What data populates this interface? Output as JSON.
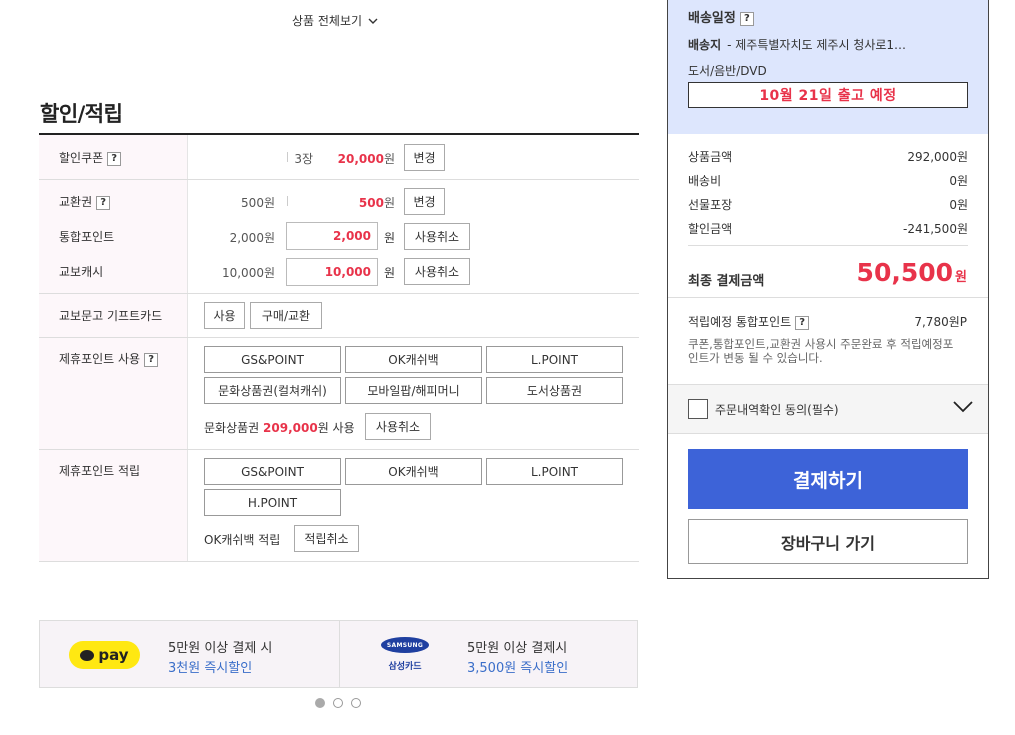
{
  "view_all": "상품 전체보기",
  "section_title": "할인/적립",
  "rows": {
    "coupon": {
      "label": "할인쿠폰",
      "count": "3장",
      "amount": "20,000",
      "won": "원",
      "btn": "변경"
    },
    "voucher": {
      "label": "교환권",
      "base": "500원",
      "amount": "500",
      "won": "원",
      "btn": "변경"
    },
    "point": {
      "label": "통합포인트",
      "base": "2,000원",
      "input": "2,000",
      "won": "원",
      "btn": "사용취소"
    },
    "cash": {
      "label": "교보캐시",
      "base": "10,000원",
      "input": "10,000",
      "won": "원",
      "btn": "사용취소"
    },
    "giftcard": {
      "label": "교보문고 기프트카드",
      "btn_use": "사용",
      "btn_buy": "구매/교환"
    },
    "partner_use": {
      "label": "제휴포인트 사용",
      "buttons": [
        "GS&POINT",
        "OK캐쉬백",
        "L.POINT",
        "문화상품권(컬쳐캐쉬)",
        "모바일팝/해피머니",
        "도서상품권"
      ],
      "status_prefix": "문화상품권",
      "status_amount": "209,000",
      "status_suffix": "원 사용",
      "btn_cancel": "사용취소"
    },
    "partner_save": {
      "label": "제휴포인트 적립",
      "buttons": [
        "GS&POINT",
        "OK캐쉬백",
        "L.POINT",
        "H.POINT"
      ],
      "status": "OK캐쉬백 적립",
      "btn_cancel": "적립취소"
    }
  },
  "banner": {
    "kpay_label": "pay",
    "kpay_line1": "5만원 이상 결제 시",
    "kpay_line2": "3천원 즉시할인",
    "samsung_logo": "SAMSUNG",
    "samsung_card": "삼성카드",
    "samsung_line1": "5만원 이상 결제시",
    "samsung_line2": "3,500원 즉시할인"
  },
  "carousel": {
    "count": 3,
    "active": 0
  },
  "panel": {
    "delivery_title": "배송일정",
    "dest_label": "배송지",
    "dest_value": "- 제주특별자치도 제주시 청사로1…",
    "category": "도서/음반/DVD",
    "ship_date": "10월 21일 출고 예정",
    "summary": [
      {
        "label": "상품금액",
        "value": "292,000원"
      },
      {
        "label": "배송비",
        "value": "0원"
      },
      {
        "label": "선물포장",
        "value": "0원"
      },
      {
        "label": "할인금액",
        "value": "-241,500원"
      }
    ],
    "final_label": "최종 결제금액",
    "final_value": "50,500",
    "final_unit": "원",
    "points_label": "적립예정 통합포인트",
    "points_value": "7,780원P",
    "note": "쿠폰,통합포인트,교환권 사용시 주문완료 후 적립예정포인트가 변동 될 수 있습니다.",
    "agree_text": "주문내역확인 동의(필수)",
    "pay_btn": "결제하기",
    "cart_btn": "장바구니 가기"
  }
}
